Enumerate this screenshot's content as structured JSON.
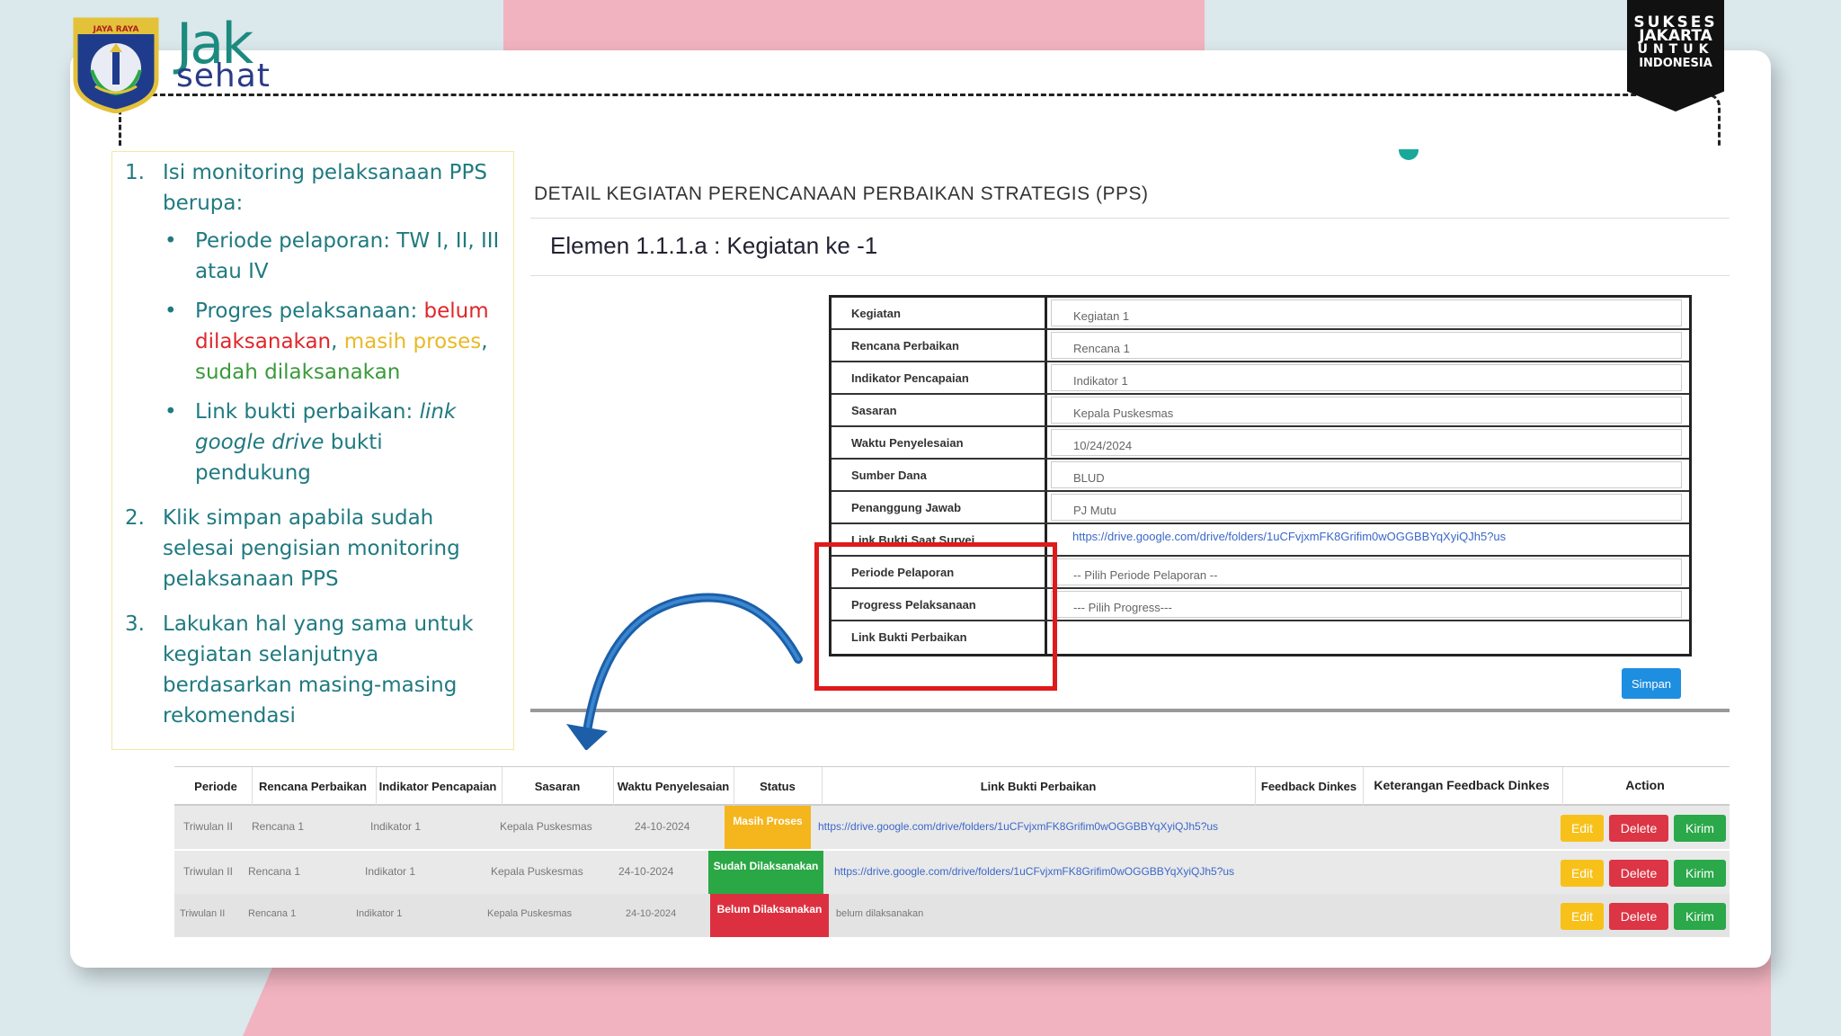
{
  "branding": {
    "crest_text": "JAYA RAYA",
    "jak": "Jak",
    "sehat": "sehat",
    "sukses_lines": [
      "SUKSES",
      "JAKARTA",
      "UNTUK",
      "INDONESIA"
    ]
  },
  "instructions": {
    "step1": {
      "num": "1.",
      "text": "Isi monitoring pelaksanaan PPS berupa:",
      "bullets": {
        "b1": "Periode pelaporan: TW I, II, III atau IV",
        "b2_prefix": "Progres pelaksanaan: ",
        "b2_red": "belum dilaksanakan",
        "b2_sep1": ", ",
        "b2_yellow": "masih proses",
        "b2_sep2": ", ",
        "b2_green": "sudah dilaksanakan",
        "b3_prefix": "Link bukti perbaikan: ",
        "b3_italic": "link google drive",
        "b3_suffix": " bukti pendukung"
      }
    },
    "step2": {
      "num": "2.",
      "text": "Klik simpan apabila sudah selesai pengisian monitoring pelaksanaan PPS"
    },
    "step3": {
      "num": "3.",
      "text": "Lakukan hal yang sama untuk kegiatan selanjutnya berdasarkan masing-masing rekomendasi"
    },
    "bullet_char": "•"
  },
  "detail": {
    "title": "DETAIL KEGIATAN PERENCANAAN PERBAIKAN STRATEGIS (PPS)",
    "element_title": "Elemen 1.1.1.a : Kegiatan ke -1",
    "rows": [
      {
        "label": "Kegiatan",
        "value": "Kegiatan 1"
      },
      {
        "label": "Rencana Perbaikan",
        "value": "Rencana 1"
      },
      {
        "label": "Indikator Pencapaian",
        "value": "Indikator 1"
      },
      {
        "label": "Sasaran",
        "value": "Kepala Puskesmas"
      },
      {
        "label": "Waktu Penyelesaian",
        "value": "10/24/2024"
      },
      {
        "label": "Sumber Dana",
        "value": "BLUD"
      },
      {
        "label": "Penanggung Jawab",
        "value": "PJ Mutu"
      },
      {
        "label": "Link Bukti Saat Survei",
        "value": "https://drive.google.com/drive/folders/1uCFvjxmFK8Grifim0wOGGBBYqXyiQJh5?us"
      },
      {
        "label": "Periode Pelaporan",
        "value": "-- Pilih Periode Pelaporan --"
      },
      {
        "label": "Progress Pelaksanaan",
        "value": "--- Pilih Progress---"
      },
      {
        "label": "Link Bukti Perbaikan",
        "value": ""
      }
    ],
    "simpan": "Simpan"
  },
  "table": {
    "headers": {
      "periode": "Periode",
      "rencana": "Rencana Perbaikan",
      "indikator": "Indikator Pencapaian",
      "sasaran": "Sasaran",
      "waktu": "Waktu Penyelesaian",
      "status": "Status",
      "link": "Link Bukti Perbaikan",
      "feedback": "Feedback Dinkes",
      "keterangan": "Keterangan Feedback Dinkes",
      "action": "Action"
    },
    "rows": [
      {
        "periode": "Triwulan II",
        "rencana": "Rencana 1",
        "indikator": "Indikator 1",
        "sasaran": "Kepala Puskesmas",
        "waktu": "24-10-2024",
        "status": "Masih Proses",
        "link": "https://drive.google.com/drive/folders/1uCFvjxmFK8Grifim0wOGGBBYqXyiQJh5?us"
      },
      {
        "periode": "Triwulan II",
        "rencana": "Rencana 1",
        "indikator": "Indikator 1",
        "sasaran": "Kepala Puskesmas",
        "waktu": "24-10-2024",
        "status": "Sudah Dilaksanakan",
        "link": "https://drive.google.com/drive/folders/1uCFvjxmFK8Grifim0wOGGBBYqXyiQJh5?us"
      },
      {
        "periode": "Triwulan II",
        "rencana": "Rencana 1",
        "indikator": "Indikator 1",
        "sasaran": "Kepala Puskesmas",
        "waktu": "24-10-2024",
        "status": "Belum Dilaksanakan",
        "link": "belum dilaksanakan"
      }
    ],
    "btn_edit": "Edit",
    "btn_delete": "Delete",
    "btn_kirim": "Kirim"
  },
  "colors": {
    "status_proses": "#f5b51c",
    "status_sudah": "#2aa845",
    "status_belum": "#dc3040",
    "highlight": "#e01a1a",
    "accent_teal": "#1f7a80"
  }
}
